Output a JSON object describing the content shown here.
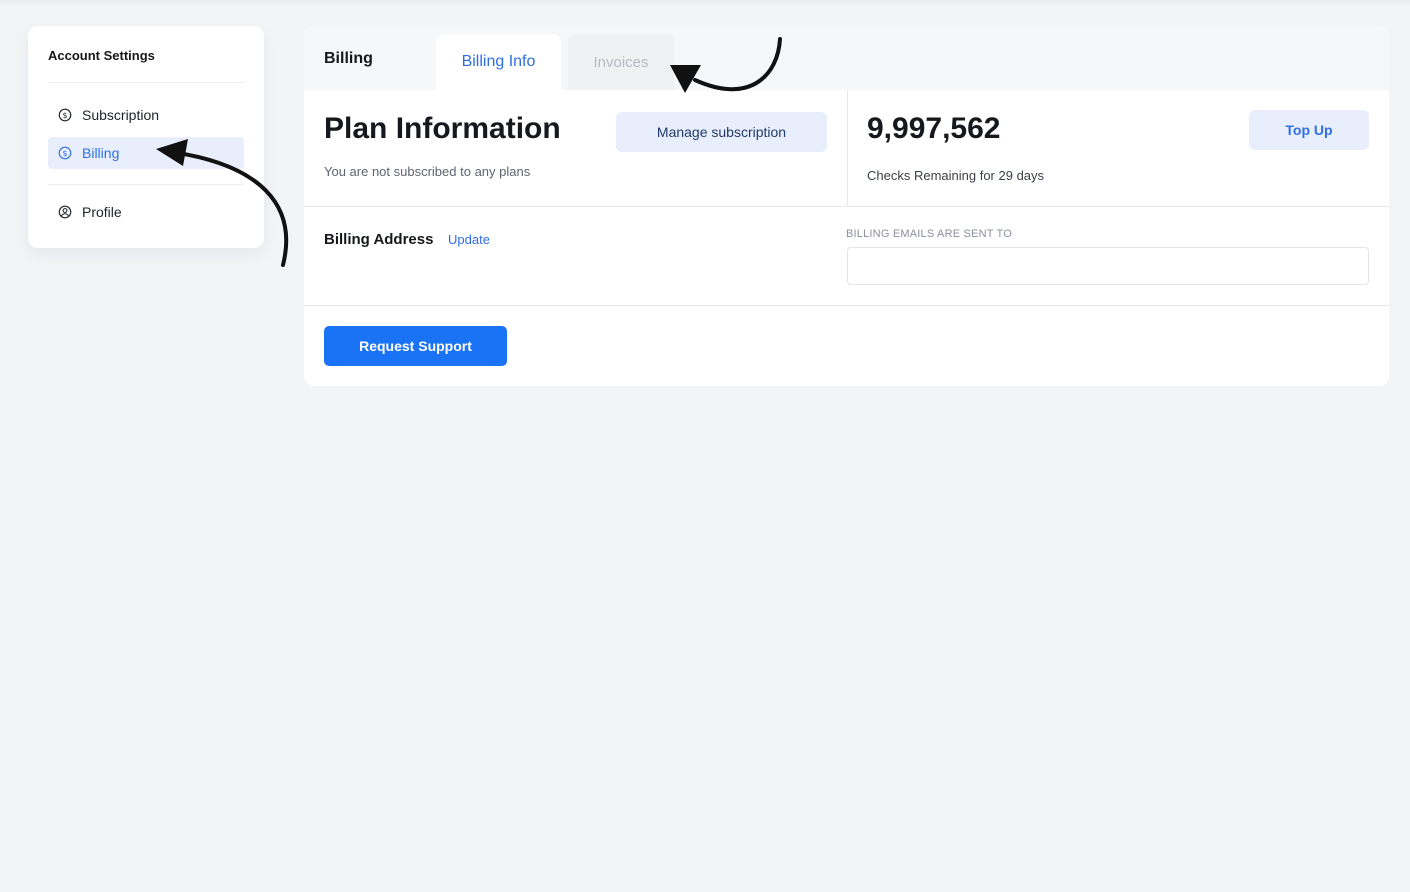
{
  "sidebar": {
    "title": "Account Settings",
    "items": [
      {
        "label": "Subscription",
        "icon": "dollar-circle-icon",
        "active": false
      },
      {
        "label": "Billing",
        "icon": "dollar-circle-icon",
        "active": true
      },
      {
        "label": "Profile",
        "icon": "user-circle-icon",
        "active": false
      }
    ]
  },
  "main": {
    "title": "Billing",
    "tabs": [
      {
        "label": "Billing Info",
        "active": true
      },
      {
        "label": "Invoices",
        "active": false
      }
    ],
    "plan": {
      "title": "Plan Information",
      "subtitle": "You are not subscribed to any plans",
      "manage_label": "Manage subscription"
    },
    "checks": {
      "value": "9,997,562",
      "subtitle": "Checks Remaining for 29 days",
      "top_up_label": "Top Up"
    },
    "billing_address": {
      "label": "Billing Address",
      "update_label": "Update"
    },
    "billing_emails": {
      "label": "BILLING EMAILS ARE SENT TO",
      "value": "",
      "placeholder": ""
    },
    "support_label": "Request Support"
  },
  "colors": {
    "accent": "#2f6fe4",
    "primary_button": "#1a73f5",
    "light_button": "#e8eefb",
    "background": "#f3f4f6"
  },
  "annotations": [
    "arrow-to-billing-icon",
    "arrow-to-invoices-icon"
  ]
}
